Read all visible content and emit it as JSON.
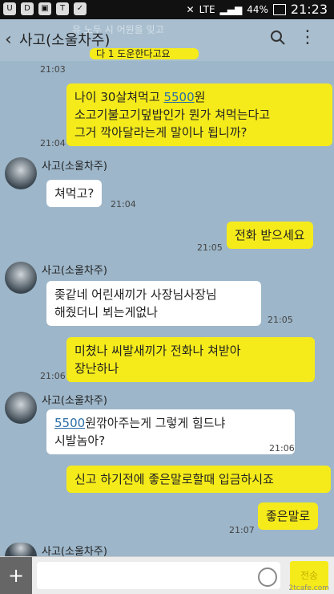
{
  "status": {
    "network": "LTE",
    "battery": "44%",
    "time": "21:23"
  },
  "header": {
    "back": "‹",
    "title": "사고(소울차주)",
    "ghost": "유 노두 시 어원을 잊고",
    "more": "⋮"
  },
  "messages": {
    "partial": {
      "text": "다 1 도운한다고요",
      "time": "21:03"
    },
    "m1": {
      "a": "나이 30살쳐먹고 ",
      "hl": "5500",
      "b": "원",
      "line2": "소고기불고기덮밥인가 뭔가 쳐먹는다고",
      "line3": "그거 깍아달라는게 말이나 됩니까?",
      "time": "21:04"
    },
    "t1": {
      "name": "사고(소울차주)",
      "text": "쳐먹고?",
      "time": "21:04"
    },
    "m2": {
      "text": "전화 받으세요",
      "time": "21:05"
    },
    "t2": {
      "name": "사고(소울차주)",
      "line1": "좆같네 어린새끼가 사장님사장님",
      "line2": "해줬더니 뵈는게없나",
      "time": "21:05"
    },
    "m3": {
      "line1": "미쳤나 씨발새끼가 전화나 쳐받아",
      "line2": "장난하나",
      "time": "21:06"
    },
    "t3": {
      "name": "사고(소울차주)",
      "hl": "5500",
      "a": "원깎아주는게 그렇게 힘드냐",
      "line2": "시발놈아?",
      "time": "21:06"
    },
    "m4": {
      "text": "신고 하기전에 좋은말로할때 입금하시죠"
    },
    "m5": {
      "text": "좋은말로",
      "time": "21:07"
    },
    "t4": {
      "name": "사고(소울차주)"
    }
  },
  "input": {
    "plus": "+",
    "send": "전송"
  },
  "watermark": "2tcafe.com",
  "colors": {
    "me": "#f5eb1a",
    "them": "#ffffff",
    "bg": "#9db6c9"
  }
}
